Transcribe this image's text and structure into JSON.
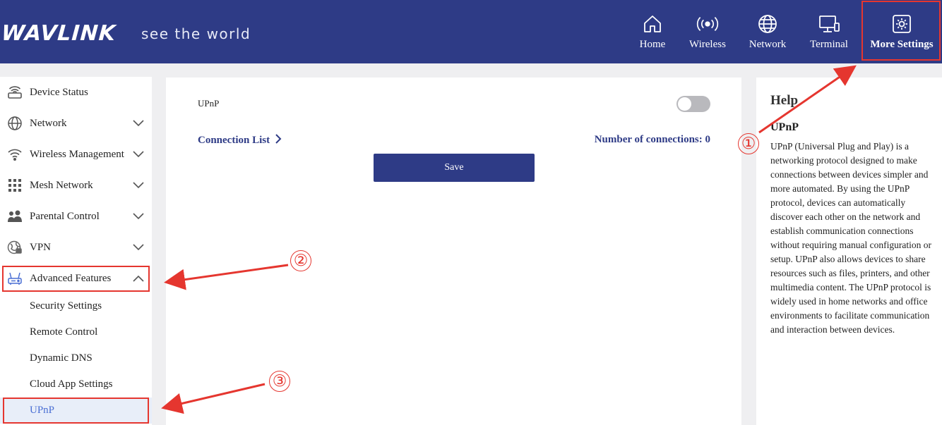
{
  "header": {
    "logo": "WAVLINK",
    "tagline": "see the world",
    "nav": [
      {
        "label": "Home",
        "icon": "home-icon"
      },
      {
        "label": "Wireless",
        "icon": "wireless-signal-icon"
      },
      {
        "label": "Network",
        "icon": "globe-icon"
      },
      {
        "label": "Terminal",
        "icon": "monitor-icon"
      },
      {
        "label": "More Settings",
        "icon": "settings-gear-icon",
        "active": true
      }
    ]
  },
  "sidebar": {
    "items": [
      {
        "label": "Device Status",
        "icon": "router-status-icon",
        "has_chevron": false
      },
      {
        "label": "Network",
        "icon": "globe-icon",
        "has_chevron": true
      },
      {
        "label": "Wireless Management",
        "icon": "wifi-icon",
        "has_chevron": true
      },
      {
        "label": "Mesh Network",
        "icon": "grid-dots-icon",
        "has_chevron": true
      },
      {
        "label": "Parental Control",
        "icon": "family-icon",
        "has_chevron": true
      },
      {
        "label": "VPN",
        "icon": "vpn-globe-icon",
        "has_chevron": true
      },
      {
        "label": "Advanced Features",
        "icon": "router-advanced-icon",
        "has_chevron": true,
        "expanded": true
      }
    ],
    "sub_items": [
      {
        "label": "Security Settings"
      },
      {
        "label": "Remote Control"
      },
      {
        "label": "Dynamic DNS"
      },
      {
        "label": "Cloud App Settings"
      },
      {
        "label": "UPnP",
        "active": true
      }
    ]
  },
  "main": {
    "upnp_label": "UPnP",
    "upnp_enabled": false,
    "connection_list_label": "Connection List",
    "connections_label": "Number of connections: 0",
    "save_label": "Save"
  },
  "help": {
    "title": "Help",
    "subtitle": "UPnP",
    "body": "UPnP (Universal Plug and Play) is a networking protocol designed to make connections between devices simpler and more automated. By using the UPnP protocol, devices can automatically discover each other on the network and establish communication connections without requiring manual configuration or setup. UPnP also allows devices to share resources such as files, printers, and other multimedia content. The UPnP protocol is widely used in home networks and office environments to facilitate communication and interaction between devices."
  },
  "annotations": {
    "markers": [
      "①",
      "②",
      "③"
    ],
    "color": "#e5362f"
  },
  "colors": {
    "header_bg": "#2e3b86",
    "accent": "#2e3b86",
    "active_sub_text": "#4a6fd4",
    "annotation_red": "#e5362f"
  }
}
